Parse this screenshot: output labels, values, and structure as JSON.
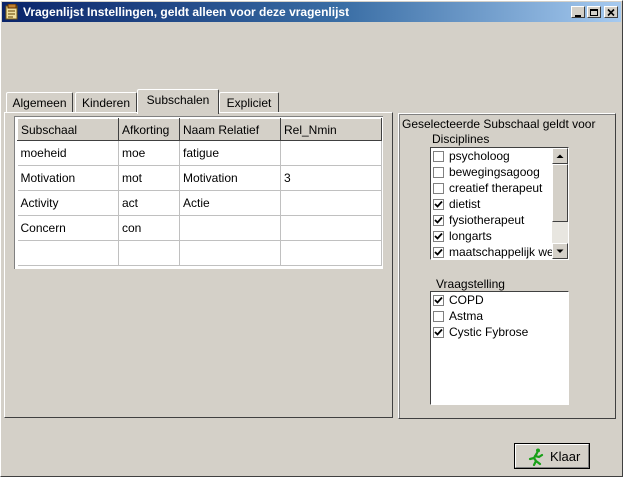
{
  "window": {
    "title": "Vragenlijst Instellingen, geldt alleen voor deze vragenlijst"
  },
  "tabs": [
    {
      "label": "Algemeen",
      "active": false
    },
    {
      "label": "Kinderen",
      "active": false
    },
    {
      "label": "Subschalen",
      "active": true
    },
    {
      "label": "Expliciet",
      "active": false
    }
  ],
  "grid": {
    "columns": [
      "Subschaal",
      "Afkorting",
      "Naam Relatief",
      "Rel_Nmin"
    ],
    "rows": [
      [
        "moeheid",
        "moe",
        "fatigue",
        ""
      ],
      [
        "Motivation",
        "mot",
        "Motivation",
        "3"
      ],
      [
        "Activity",
        "act",
        "Actie",
        ""
      ],
      [
        "Concern",
        "con",
        "",
        ""
      ],
      [
        "",
        "",
        "",
        ""
      ]
    ]
  },
  "groupbox": {
    "title": "Geselecteerde Subschaal geldt voor",
    "disciplines_label": "Disciplines",
    "disciplines": [
      {
        "label": "psycholoog",
        "checked": false
      },
      {
        "label": "bewegingsagoog",
        "checked": false
      },
      {
        "label": "creatief therapeut",
        "checked": false
      },
      {
        "label": "dietist",
        "checked": true
      },
      {
        "label": "fysiotherapeut",
        "checked": true
      },
      {
        "label": "longarts",
        "checked": true
      },
      {
        "label": "maatschappelijk werker",
        "checked": true
      }
    ],
    "vraagstelling_label": "Vraagstelling",
    "vraagstelling": [
      {
        "label": "COPD",
        "checked": true
      },
      {
        "label": "Astma",
        "checked": false
      },
      {
        "label": "Cystic Fybrose",
        "checked": true
      }
    ]
  },
  "buttons": {
    "klaar_label": "Klaar"
  },
  "icons": {
    "app": "app-icon",
    "minimize": "minimize-icon",
    "maximize": "maximize-icon",
    "close": "close-icon",
    "klaar": "running-man-icon"
  }
}
